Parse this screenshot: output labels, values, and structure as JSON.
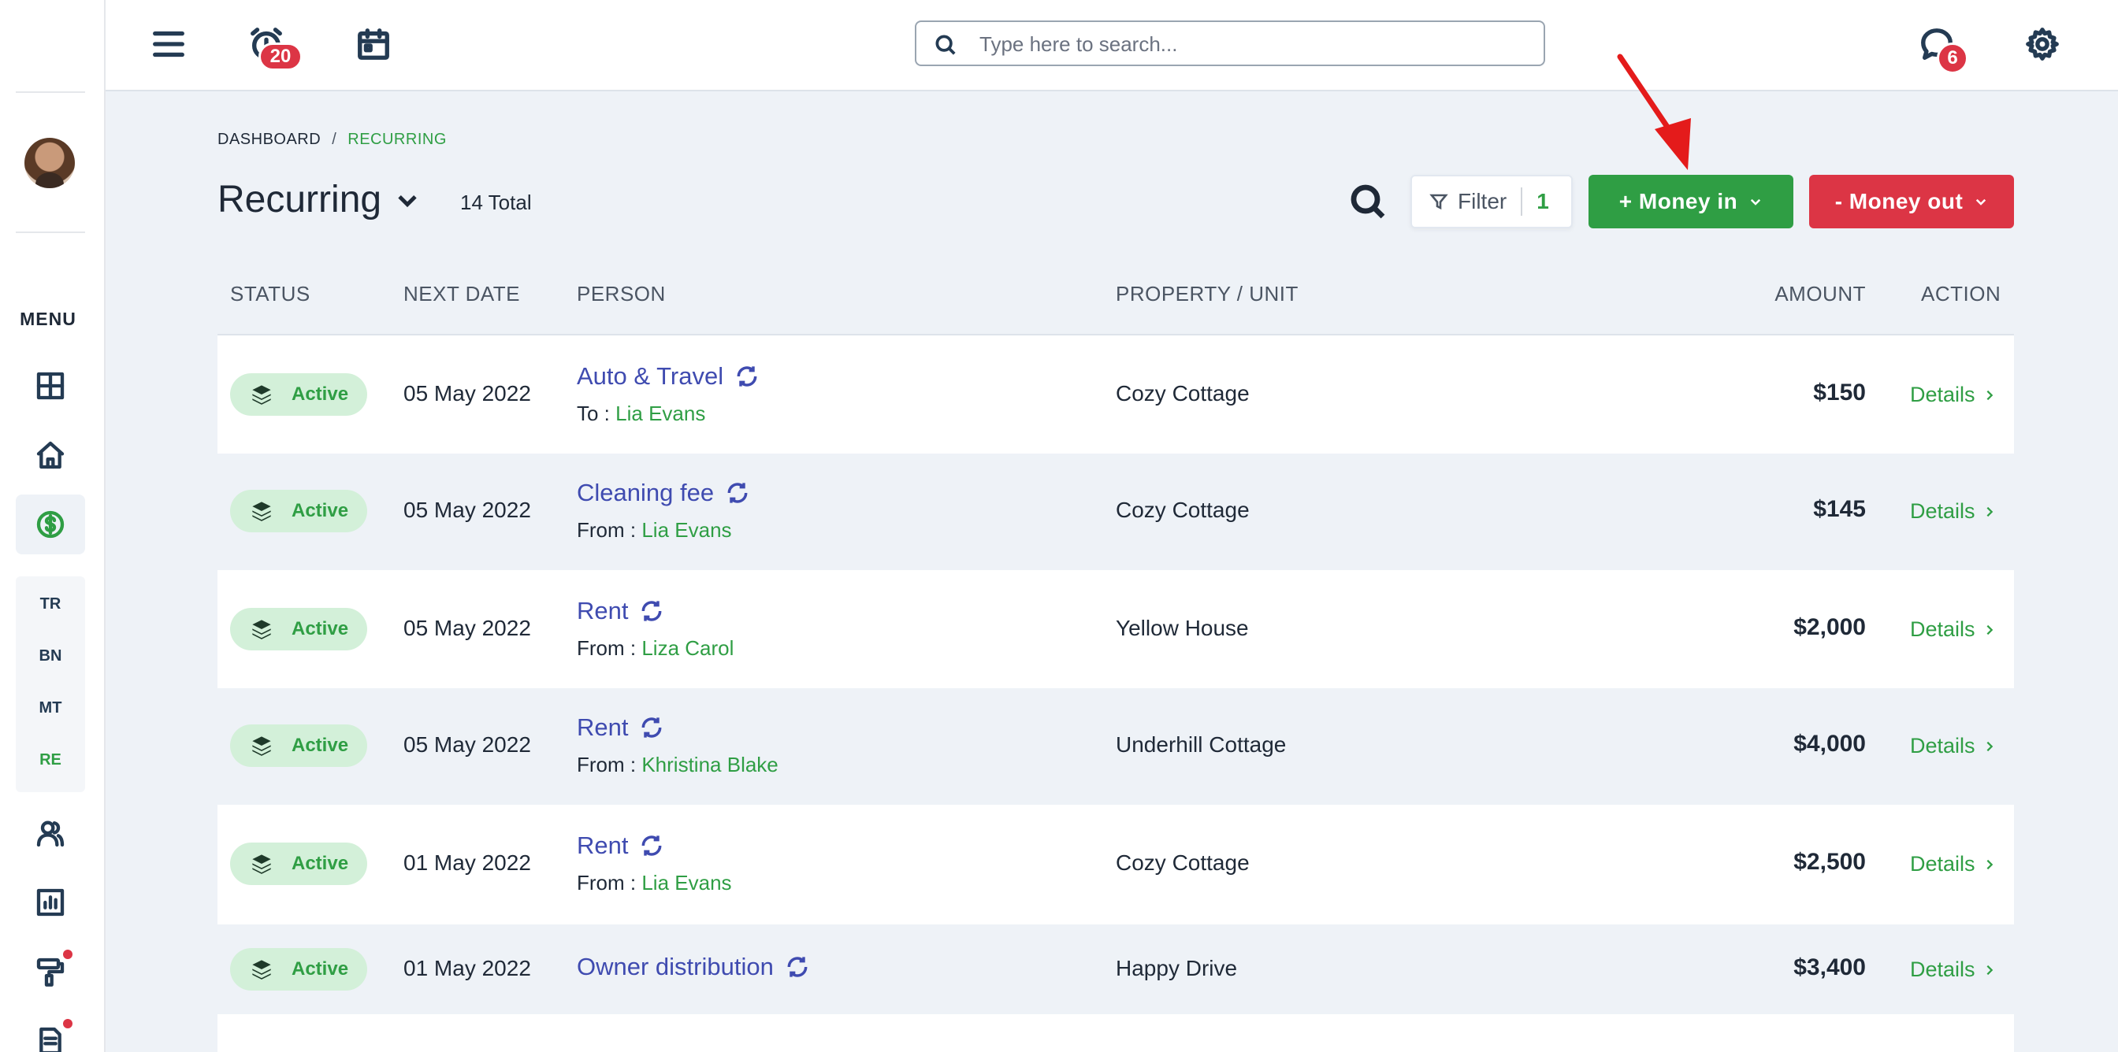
{
  "sidebar": {
    "menu_label": "MENU",
    "sub_items": [
      "TR",
      "BN",
      "MT",
      "RE"
    ],
    "active_sub": "RE"
  },
  "topbar": {
    "alarm_badge": "20",
    "chat_badge": "6",
    "search_placeholder": "Type here to search..."
  },
  "breadcrumb": {
    "root": "DASHBOARD",
    "separator": "/",
    "current": "RECURRING"
  },
  "header": {
    "title": "Recurring",
    "total": "14 Total",
    "filter_label": "Filter",
    "filter_count": "1",
    "money_in_label": "+ Money in",
    "money_out_label": "- Money out"
  },
  "table": {
    "columns": [
      "STATUS",
      "NEXT DATE",
      "PERSON",
      "PROPERTY / UNIT",
      "AMOUNT",
      "ACTION"
    ],
    "rows": [
      {
        "status": "Active",
        "date": "05 May 2022",
        "title": "Auto & Travel",
        "direction": "To :",
        "name": "Lia Evans",
        "property": "Cozy Cottage",
        "amount": "$150",
        "action": "Details"
      },
      {
        "status": "Active",
        "date": "05 May 2022",
        "title": "Cleaning fee",
        "direction": "From :",
        "name": "Lia Evans",
        "property": "Cozy Cottage",
        "amount": "$145",
        "action": "Details"
      },
      {
        "status": "Active",
        "date": "05 May 2022",
        "title": "Rent",
        "direction": "From :",
        "name": "Liza Carol",
        "property": "Yellow House",
        "amount": "$2,000",
        "action": "Details"
      },
      {
        "status": "Active",
        "date": "05 May 2022",
        "title": "Rent",
        "direction": "From :",
        "name": "Khristina Blake",
        "property": "Underhill Cottage",
        "amount": "$4,000",
        "action": "Details"
      },
      {
        "status": "Active",
        "date": "01 May 2022",
        "title": "Rent",
        "direction": "From :",
        "name": "Lia Evans",
        "property": "Cozy Cottage",
        "amount": "$2,500",
        "action": "Details"
      },
      {
        "status": "Active",
        "date": "01 May 2022",
        "title": "Owner distribution",
        "direction": "",
        "name": "",
        "property": "Happy Drive",
        "amount": "$3,400",
        "action": "Details"
      }
    ]
  },
  "colors": {
    "accent_green": "#2f9e44",
    "danger_red": "#dc3545",
    "link_indigo": "#3f4bb0"
  }
}
